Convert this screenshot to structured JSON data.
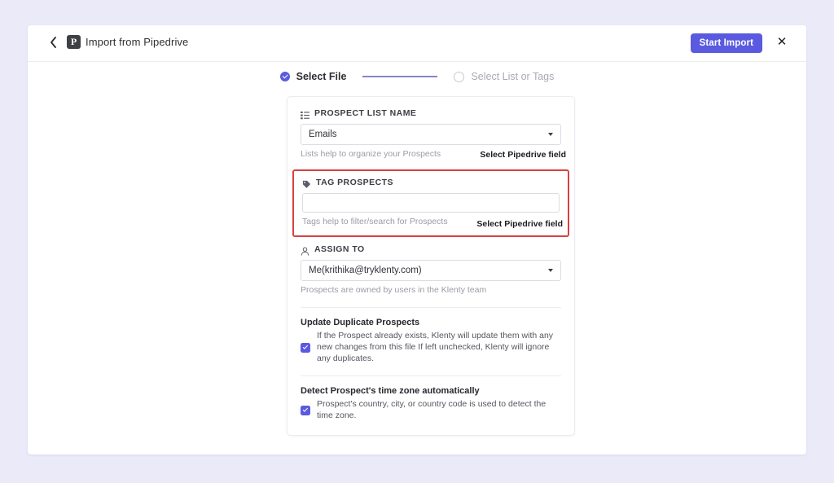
{
  "header": {
    "back_icon": "chevron-left-icon",
    "logo_letter": "P",
    "logo_name": "pipedrive-logo",
    "title": "Import from Pipedrive",
    "start_import_label": "Start Import",
    "close_icon": "✕",
    "accent_color": "#5a5ae0"
  },
  "stepper": {
    "steps": [
      {
        "label": "Select File",
        "state": "done"
      },
      {
        "label": "Select List or Tags",
        "state": "todo"
      }
    ]
  },
  "form": {
    "prospect_list": {
      "icon": "list-icon",
      "title": "PROSPECT LIST NAME",
      "value": "Emails",
      "hint": "Lists help to organize your Prospects",
      "field_selector_label": "Select Pipedrive field"
    },
    "tag_prospects": {
      "icon": "tag-icon",
      "title": "TAG PROSPECTS",
      "value": "",
      "placeholder": "",
      "hint": "Tags help to filter/search for Prospects",
      "field_selector_label": "Select Pipedrive field",
      "highlight_color": "#d94141"
    },
    "assign_to": {
      "icon": "person-icon",
      "title": "ASSIGN TO",
      "value": "Me(krithika@tryklenty.com)",
      "hint": "Prospects are owned by users in the Klenty team"
    },
    "update_duplicates": {
      "title": "Update Duplicate Prospects",
      "description": "If the Prospect already exists, Klenty will update them with any new changes from this file If left unchecked, Klenty will ignore any duplicates.",
      "checked": true
    },
    "detect_timezone": {
      "title": "Detect Prospect's time zone automatically",
      "description": "Prospect's country, city, or country code is used to detect the time zone.",
      "checked": true
    }
  }
}
